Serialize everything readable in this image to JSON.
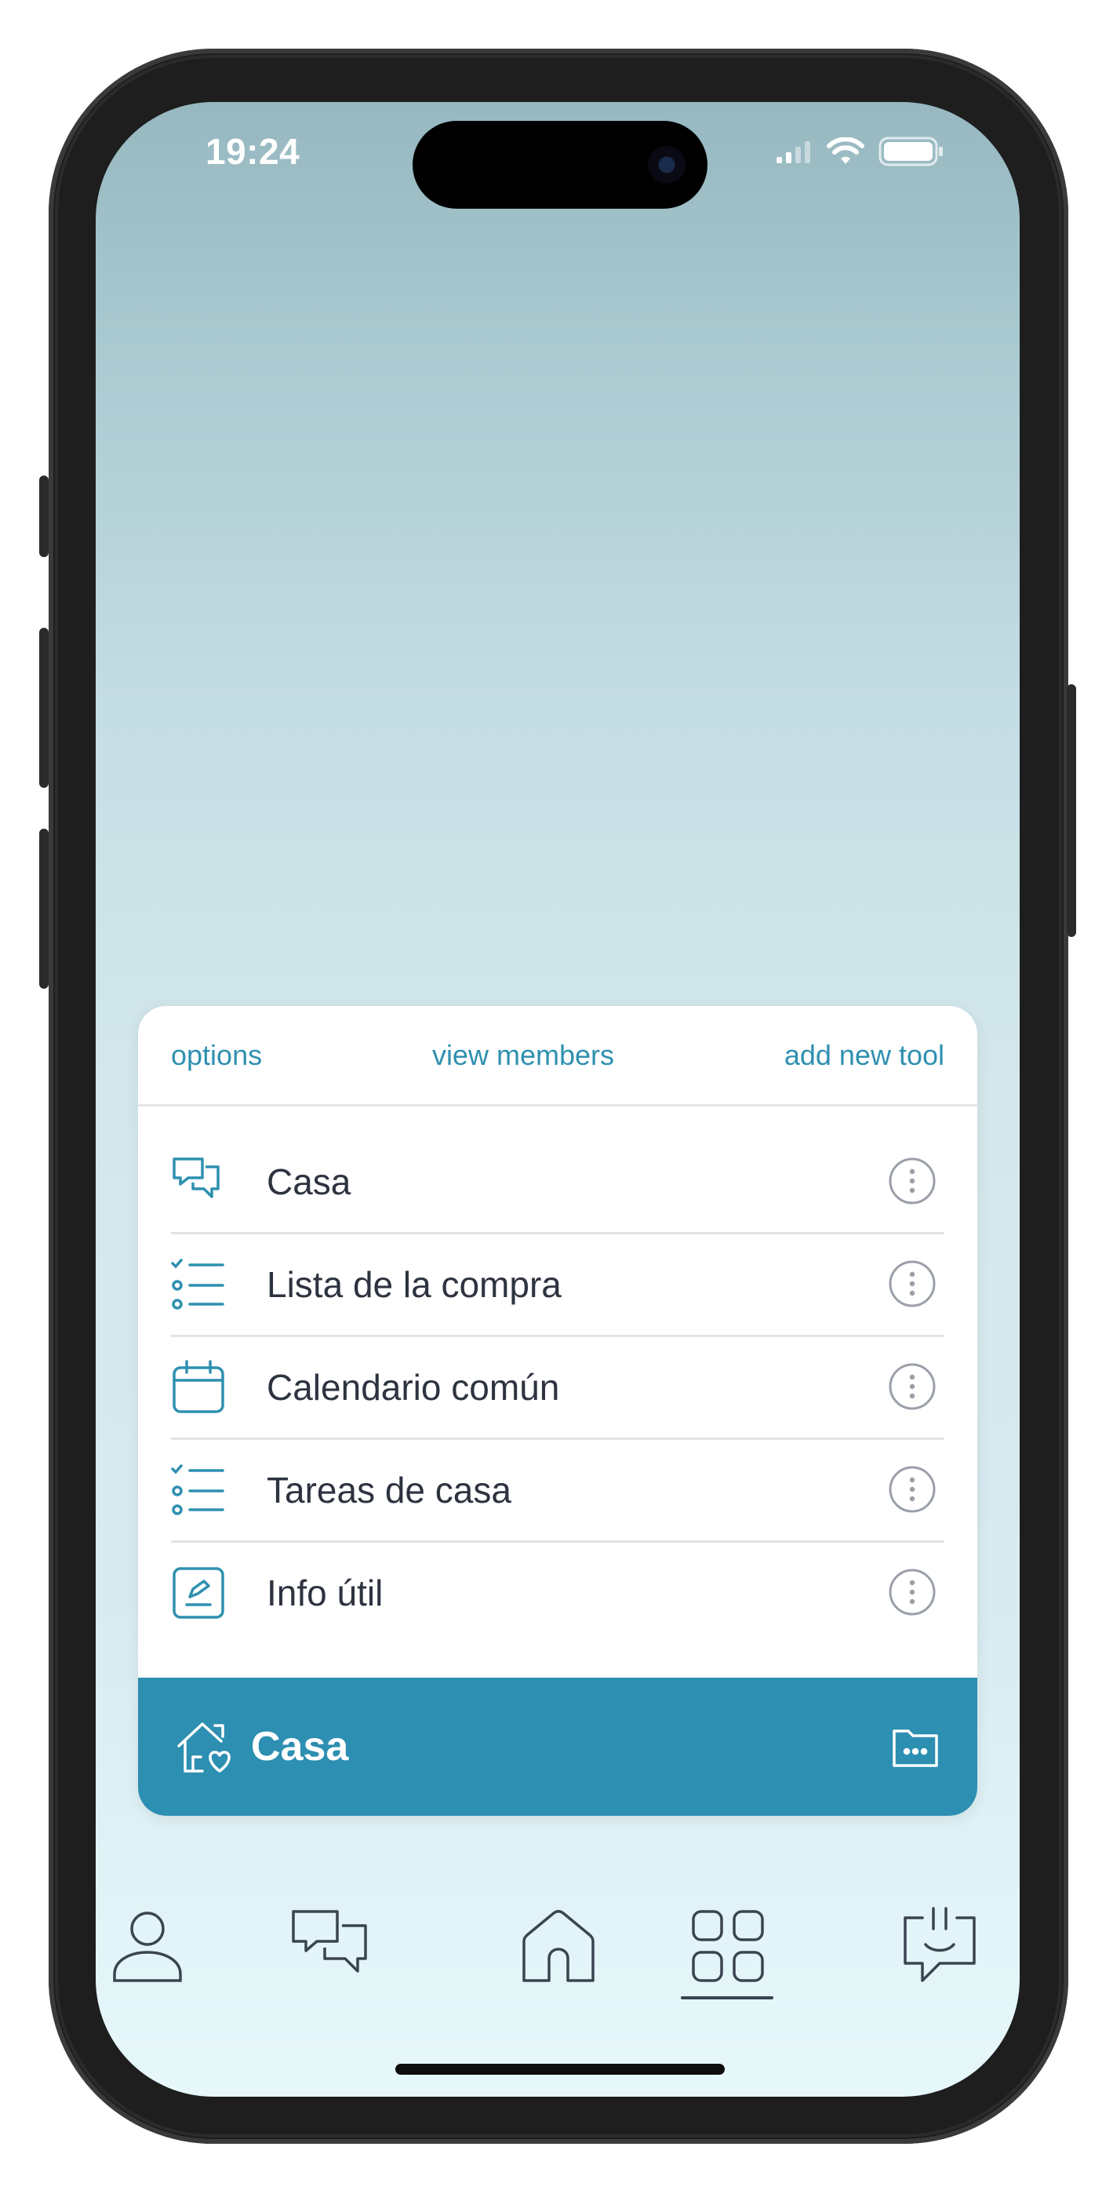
{
  "status_bar": {
    "time": "19:24"
  },
  "card": {
    "header": {
      "options_label": "options",
      "members_label": "view members",
      "add_tool_label": "add new tool"
    },
    "items": [
      {
        "label": "Casa",
        "icon": "chat-icon"
      },
      {
        "label": "Lista de la compra",
        "icon": "checklist-icon"
      },
      {
        "label": "Calendario común",
        "icon": "calendar-icon"
      },
      {
        "label": "Tareas de casa",
        "icon": "checklist-icon"
      },
      {
        "label": "Info útil",
        "icon": "note-icon"
      }
    ],
    "footer": {
      "title": "Casa",
      "icon": "home-heart-icon",
      "action_icon": "folder-more-icon"
    }
  },
  "tabbar": {
    "tabs": [
      {
        "icon": "profile-icon"
      },
      {
        "icon": "chat-icon"
      },
      {
        "icon": "home-icon"
      },
      {
        "icon": "grid-icon",
        "selected": true
      },
      {
        "icon": "feedback-icon"
      }
    ]
  },
  "colors": {
    "accent": "#2d8fb1",
    "link": "#2f90b0",
    "text": "#2e3340",
    "icon_gray": "#9a9fa8"
  }
}
